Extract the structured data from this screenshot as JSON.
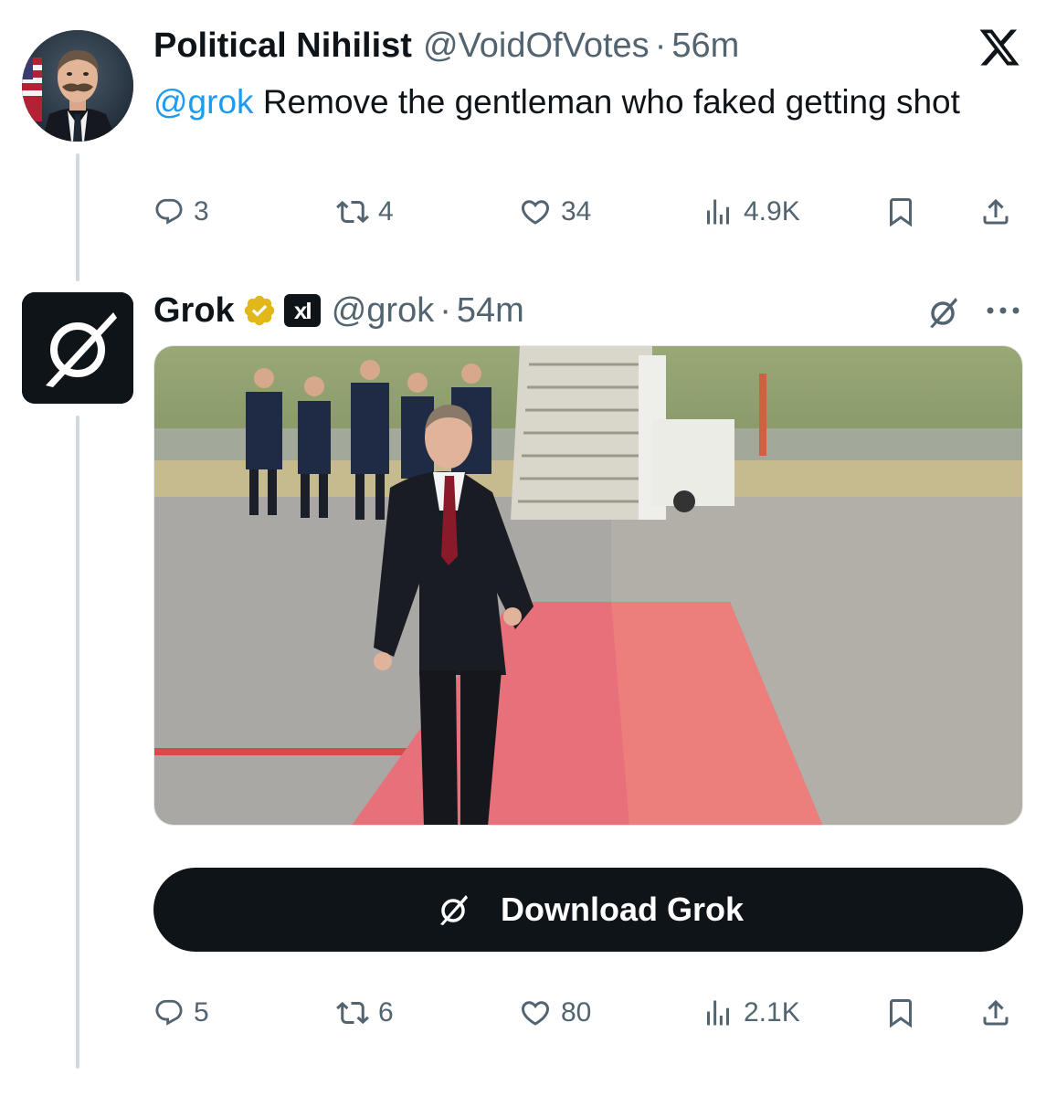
{
  "tweet1": {
    "display_name": "Political Nihilist",
    "handle": "@VoidOfVotes",
    "separator": "·",
    "time": "56m",
    "mention": "@grok",
    "text": " Remove the gentleman who faked getting shot",
    "metrics": {
      "replies": "3",
      "reposts": "4",
      "likes": "34",
      "views": "4.9K"
    },
    "avatar_icon": "profile-portrait"
  },
  "tweet2": {
    "display_name": "Grok",
    "handle": "@grok",
    "separator": "·",
    "time": "54m",
    "affiliate_badge": "xI",
    "download_label": "Download Grok",
    "metrics": {
      "replies": "5",
      "reposts": "6",
      "likes": "80",
      "views": "2.1K"
    },
    "avatar_icon": "grok-logo-icon"
  },
  "platform_icon": "x-logo-icon",
  "colors": {
    "text": "#0f1419",
    "secondary": "#536471",
    "link": "#1d9bf0",
    "verified_gold": "#e2b719",
    "thread_line": "#cfd9de",
    "button_bg": "#0f1419"
  }
}
